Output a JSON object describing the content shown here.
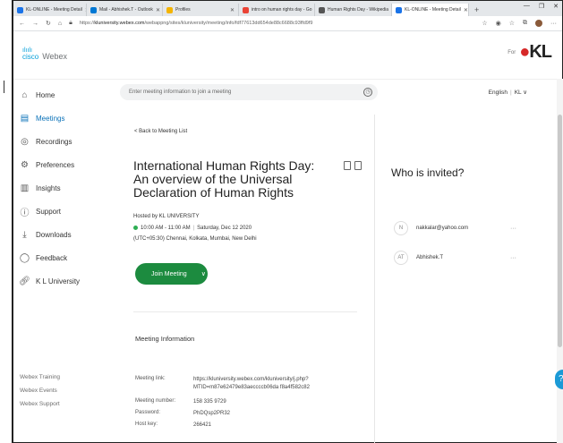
{
  "browser": {
    "tabs": [
      {
        "label": "KL-ONLINE - Meeting Detail",
        "icon_color": "#1a73e8",
        "active": false
      },
      {
        "label": "Mail - Abhishek.T - Outlook",
        "icon_color": "#0078d4",
        "active": false
      },
      {
        "label": "Profiles",
        "icon_color": "#f4b400",
        "active": false
      },
      {
        "label": "intro on human rights day - Go",
        "icon_color": "#ea4335",
        "active": false
      },
      {
        "label": "Human Rights Day - Wikipedia",
        "icon_color": "#555555",
        "active": false
      },
      {
        "label": "KL-ONLINE - Meeting Detail",
        "icon_color": "#1a73e8",
        "active": true
      }
    ],
    "new_tab": "+",
    "url_prefix": "https://",
    "url_host": "kluniversity.webex.com",
    "url_path": "/webappng/sites/kluniversity/meeting/info/fdf77613dd654de88c6688c93ffd9f9"
  },
  "header": {
    "brand_top": "cisco",
    "brand_name": "Webex",
    "for_label": "For",
    "kl_logo": "KL"
  },
  "sidebar": {
    "items": [
      {
        "label": "Home",
        "icon": "home-icon"
      },
      {
        "label": "Meetings",
        "icon": "meetings-icon"
      },
      {
        "label": "Recordings",
        "icon": "recordings-icon"
      },
      {
        "label": "Preferences",
        "icon": "gear-icon"
      },
      {
        "label": "Insights",
        "icon": "insights-icon"
      },
      {
        "label": "Support",
        "icon": "help-icon"
      },
      {
        "label": "Downloads",
        "icon": "download-icon"
      },
      {
        "label": "Feedback",
        "icon": "feedback-icon"
      },
      {
        "label": "K L University",
        "icon": "link-icon"
      }
    ],
    "footer_links": [
      "Webex Training",
      "Webex Events",
      "Webex Support"
    ]
  },
  "search": {
    "placeholder": "Enter meeting information to join a meeting"
  },
  "language": {
    "label": "English",
    "user": "KL"
  },
  "meeting": {
    "back_label": "< Back to Meeting List",
    "title": "International Human Rights Day: An overview of the Universal Declaration of Human Rights",
    "host": "Hosted by KL UNIVERSITY",
    "time": "10:00 AM - 11:00 AM",
    "date": "Saturday, Dec 12 2020",
    "timezone": "(UTC+05:30) Chennai, Kolkata, Mumbai, New Delhi",
    "join_label": "Join Meeting",
    "info_heading": "Meeting Information",
    "info": {
      "link_key": "Meeting link:",
      "link_value": "https://kluniversity.webex.com/kluniversity/j.php?MTID=m87e62479e83aeccccb06da f8a4f582c82",
      "number_key": "Meeting number:",
      "number_value": "158 335 9729",
      "password_key": "Password:",
      "password_value": "PhDQsp2PR32",
      "hostkey_key": "Host key:",
      "hostkey_value": "266421"
    }
  },
  "invited": {
    "heading": "Who is invited?",
    "people": [
      {
        "initial": "N",
        "name": "nakkalar@yahoo.com"
      },
      {
        "initial": "AT",
        "name": "Abhishek.T"
      }
    ],
    "more": "···"
  },
  "help_label": "?"
}
